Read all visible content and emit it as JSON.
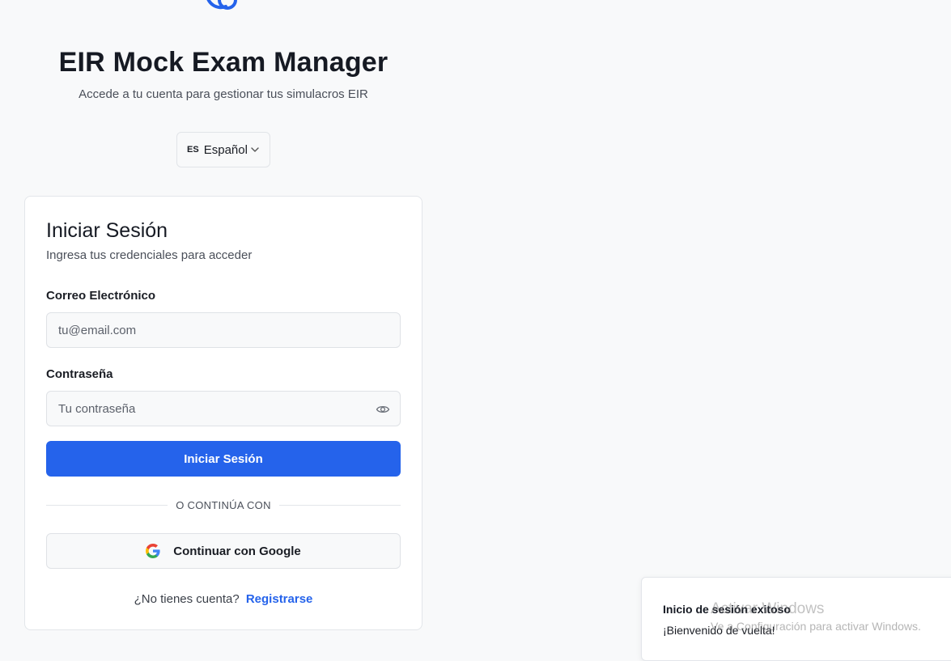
{
  "header": {
    "logo_icon": "stethoscope-icon",
    "title": "EIR Mock Exam Manager",
    "subtitle": "Accede a tu cuenta para gestionar tus simulacros EIR"
  },
  "language": {
    "code": "ES",
    "selected": "Español",
    "icon": "chevron-down-icon"
  },
  "login_card": {
    "title": "Iniciar Sesión",
    "description": "Ingresa tus credenciales para acceder",
    "email": {
      "label": "Correo Electrónico",
      "placeholder": "tu@email.com",
      "value": ""
    },
    "password": {
      "label": "Contraseña",
      "placeholder": "Tu contraseña",
      "value": "",
      "icon": "eye-icon"
    },
    "submit_label": "Iniciar Sesión",
    "divider_label": "O CONTINÚA CON",
    "google_label": "Continuar con Google",
    "signup_prompt": "¿No tienes cuenta?",
    "signup_link": "Registrarse"
  },
  "toast": {
    "title": "Inicio de sesión exitoso",
    "message": "¡Bienvenido de vuelta!"
  },
  "os_watermark": {
    "line1": "Activar Windows",
    "line2": "Ve a Configuración para activar Windows."
  },
  "colors": {
    "primary": "#2563eb",
    "background": "#f8f9fa",
    "card": "#ffffff",
    "text": "#1a1d24",
    "muted_text": "#4a4f59"
  }
}
